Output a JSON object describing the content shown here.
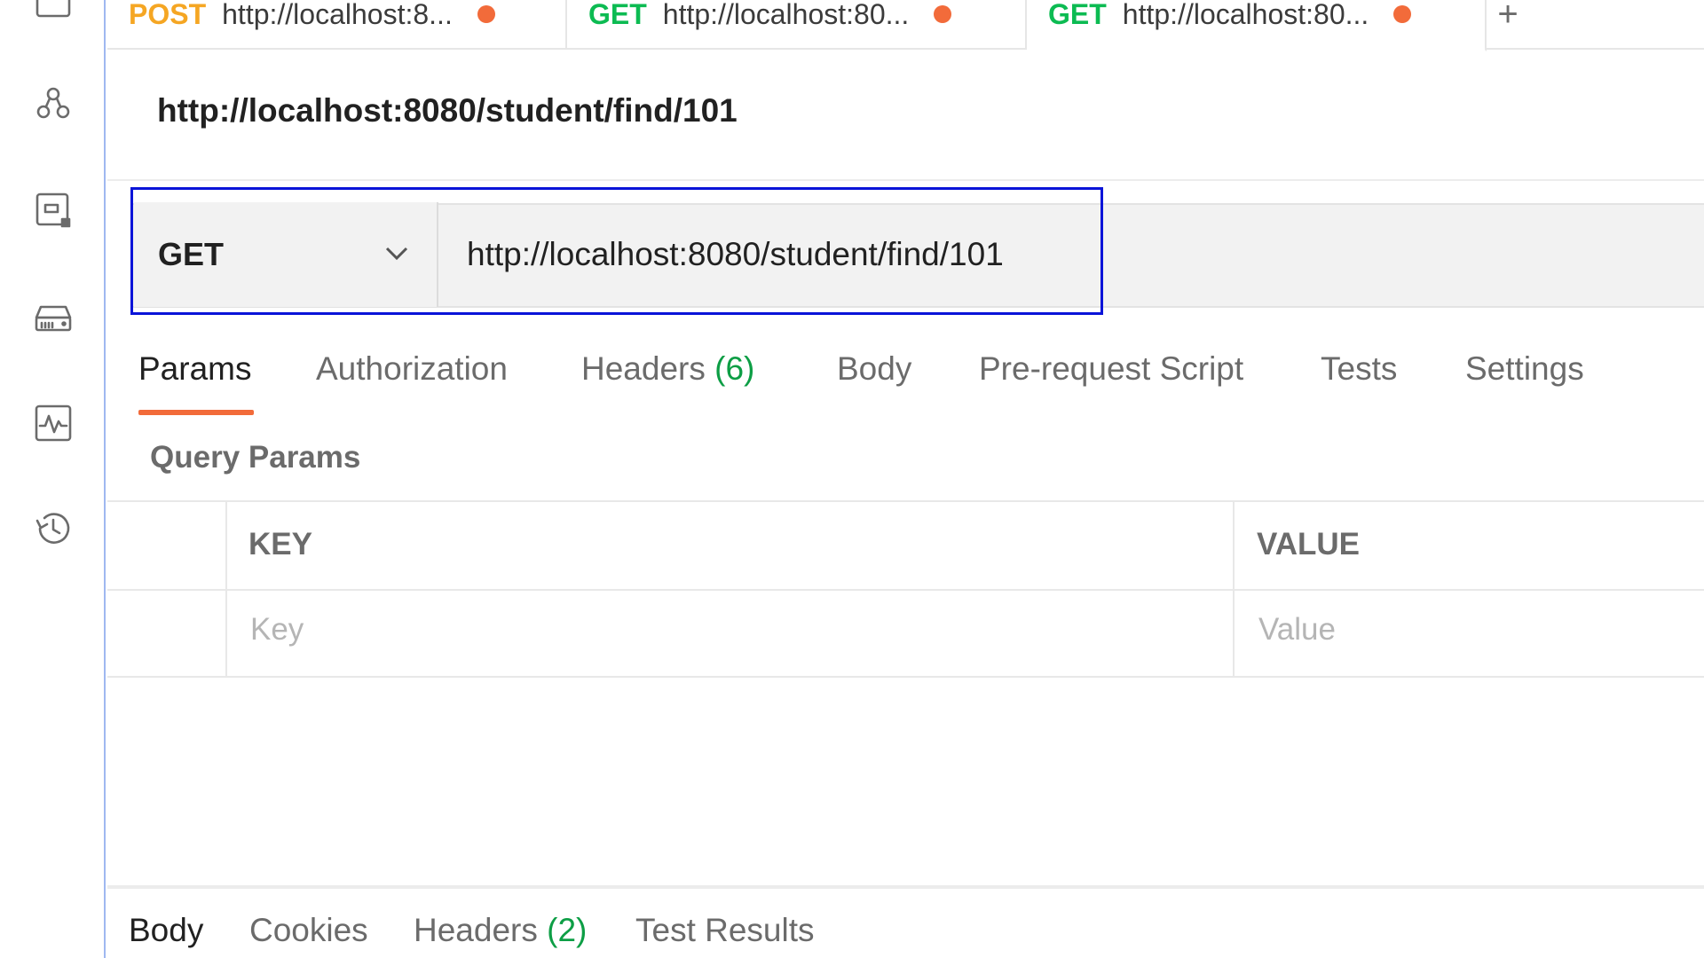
{
  "sidebar": {
    "icons": [
      "window-icon",
      "apis-icon",
      "mock-servers-icon",
      "environments-icon",
      "monitors-icon",
      "history-icon"
    ]
  },
  "tabs": [
    {
      "method": "POST",
      "url": "http://localhost:8...",
      "unsaved": true
    },
    {
      "method": "GET",
      "url": "http://localhost:80...",
      "unsaved": true
    },
    {
      "method": "GET",
      "url": "http://localhost:80...",
      "unsaved": true,
      "active": true
    }
  ],
  "new_tab_label": "+",
  "request": {
    "title": "http://localhost:8080/student/find/101",
    "method": "GET",
    "url": "http://localhost:8080/student/find/101"
  },
  "options_tabs": {
    "params": "Params",
    "authorization": "Authorization",
    "headers": "Headers",
    "headers_count": "(6)",
    "body": "Body",
    "prerequest": "Pre-request Script",
    "tests": "Tests",
    "settings": "Settings"
  },
  "query_params": {
    "label": "Query Params",
    "headers": {
      "key": "KEY",
      "value": "VALUE"
    },
    "placeholders": {
      "key": "Key",
      "value": "Value"
    }
  },
  "response_tabs": {
    "body": "Body",
    "cookies": "Cookies",
    "headers": "Headers",
    "headers_count": "(2)",
    "test_results": "Test Results"
  },
  "colors": {
    "accent": "#f26b3a",
    "get": "#0cbb52",
    "post": "#f5a623",
    "highlight_border": "#0a14d8",
    "count_green": "#0d9e45"
  }
}
